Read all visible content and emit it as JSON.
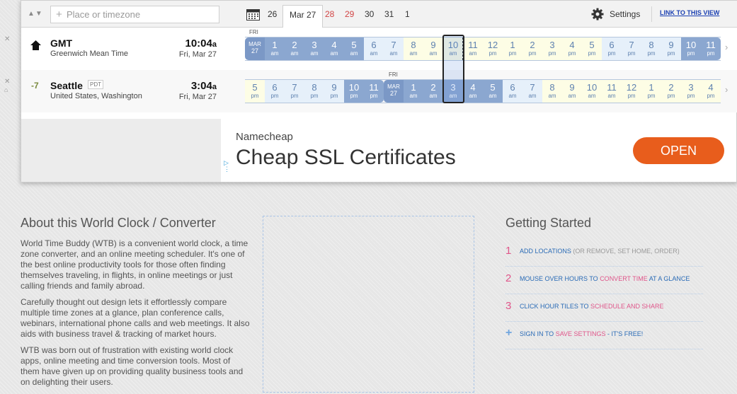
{
  "toolbar": {
    "search_placeholder": "Place or timezone",
    "dates": [
      {
        "label": "26",
        "weekend": false
      },
      {
        "label": "Mar 27",
        "active": true
      },
      {
        "label": "28",
        "weekend": true
      },
      {
        "label": "29",
        "weekend": true
      },
      {
        "label": "30",
        "weekend": false
      },
      {
        "label": "31",
        "weekend": false
      },
      {
        "label": "1",
        "weekend": false
      }
    ],
    "settings_label": "Settings",
    "link_view_label": "LINK TO THIS VIEW"
  },
  "rows": [
    {
      "city": "GMT",
      "description": "Greenwich Mean Time",
      "time": "10:04",
      "ampm": "a",
      "date": "Fri, Mar 27",
      "day_label": "FRI",
      "date_cell": {
        "month": "MAR",
        "day": "27"
      },
      "hours": [
        [
          "1",
          "am"
        ],
        [
          "2",
          "am"
        ],
        [
          "3",
          "am"
        ],
        [
          "4",
          "am"
        ],
        [
          "5",
          "am"
        ],
        [
          "6",
          "am"
        ],
        [
          "7",
          "am"
        ],
        [
          "8",
          "am"
        ],
        [
          "9",
          "am"
        ],
        [
          "10",
          "am"
        ],
        [
          "11",
          "am"
        ],
        [
          "12",
          "pm"
        ],
        [
          "1",
          "pm"
        ],
        [
          "2",
          "pm"
        ],
        [
          "3",
          "pm"
        ],
        [
          "4",
          "pm"
        ],
        [
          "5",
          "pm"
        ],
        [
          "6",
          "pm"
        ],
        [
          "7",
          "pm"
        ],
        [
          "8",
          "pm"
        ],
        [
          "9",
          "pm"
        ],
        [
          "10",
          "pm"
        ],
        [
          "11",
          "pm"
        ]
      ]
    },
    {
      "offset": "-7",
      "city": "Seattle",
      "abbr": "PDT",
      "description": "United States, Washington",
      "time": "3:04",
      "ampm": "a",
      "date": "Fri, Mar 27",
      "day_label": "FRI",
      "date_cell": {
        "month": "MAR",
        "day": "27"
      },
      "hours": [
        [
          "5",
          "pm"
        ],
        [
          "6",
          "pm"
        ],
        [
          "7",
          "pm"
        ],
        [
          "8",
          "pm"
        ],
        [
          "9",
          "pm"
        ],
        [
          "10",
          "pm"
        ],
        [
          "11",
          "pm"
        ],
        [
          "1",
          "am"
        ],
        [
          "2",
          "am"
        ],
        [
          "3",
          "am"
        ],
        [
          "4",
          "am"
        ],
        [
          "5",
          "am"
        ],
        [
          "6",
          "am"
        ],
        [
          "7",
          "am"
        ],
        [
          "8",
          "am"
        ],
        [
          "9",
          "am"
        ],
        [
          "10",
          "am"
        ],
        [
          "11",
          "am"
        ],
        [
          "12",
          "pm"
        ],
        [
          "1",
          "pm"
        ],
        [
          "2",
          "pm"
        ],
        [
          "3",
          "pm"
        ],
        [
          "4",
          "pm"
        ]
      ]
    }
  ],
  "ad": {
    "brand": "Namecheap",
    "headline": "Cheap SSL Certificates",
    "cta": "OPEN"
  },
  "about": {
    "title": "About this World Clock / Converter",
    "paragraphs": [
      "World Time Buddy (WTB) is a convenient world clock, a time zone converter, and an online meeting scheduler. It's one of the best online productivity tools for those often finding themselves traveling, in flights, in online meetings or just calling friends and family abroad.",
      "Carefully thought out design lets it effortlessly compare multiple time zones at a glance, plan conference calls, webinars, international phone calls and web meetings. It also aids with business travel & tracking of market hours.",
      "WTB was born out of frustration with existing world clock apps, online meeting and time conversion tools. Most of them have given up on providing quality business tools and on delighting their users."
    ]
  },
  "getting_started": {
    "title": "Getting Started",
    "steps": [
      {
        "num": "1",
        "parts": [
          "ADD LOCATIONS",
          " (OR REMOVE, SET HOME, ORDER)"
        ]
      },
      {
        "num": "2",
        "parts": [
          "MOUSE OVER HOURS TO ",
          "CONVERT TIME",
          " AT A GLANCE"
        ]
      },
      {
        "num": "3",
        "parts": [
          "CLICK HOUR TILES TO ",
          "SCHEDULE AND SHARE"
        ]
      },
      {
        "num": "+",
        "parts": [
          "SIGN IN TO ",
          "SAVE SETTINGS",
          " - IT'S FREE!"
        ]
      }
    ]
  }
}
